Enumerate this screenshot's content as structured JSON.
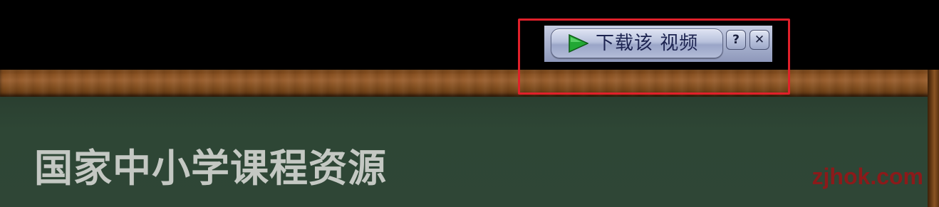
{
  "page": {
    "site_title": "国家中小学课程资源",
    "watermark": "zjhok.com"
  },
  "download_panel": {
    "download_label": "下载该 视频",
    "help_label": "?",
    "close_label": "✕",
    "icons": {
      "play": "play-icon",
      "help": "help-icon",
      "close": "close-icon"
    }
  },
  "colors": {
    "board": "#2f4636",
    "wood": "#8a5222",
    "title_text": "#c4c8c3",
    "watermark": "#8b1a1a",
    "highlight_border": "#e0202a",
    "panel": "#a9b2cf",
    "play_icon": "#22a834"
  }
}
